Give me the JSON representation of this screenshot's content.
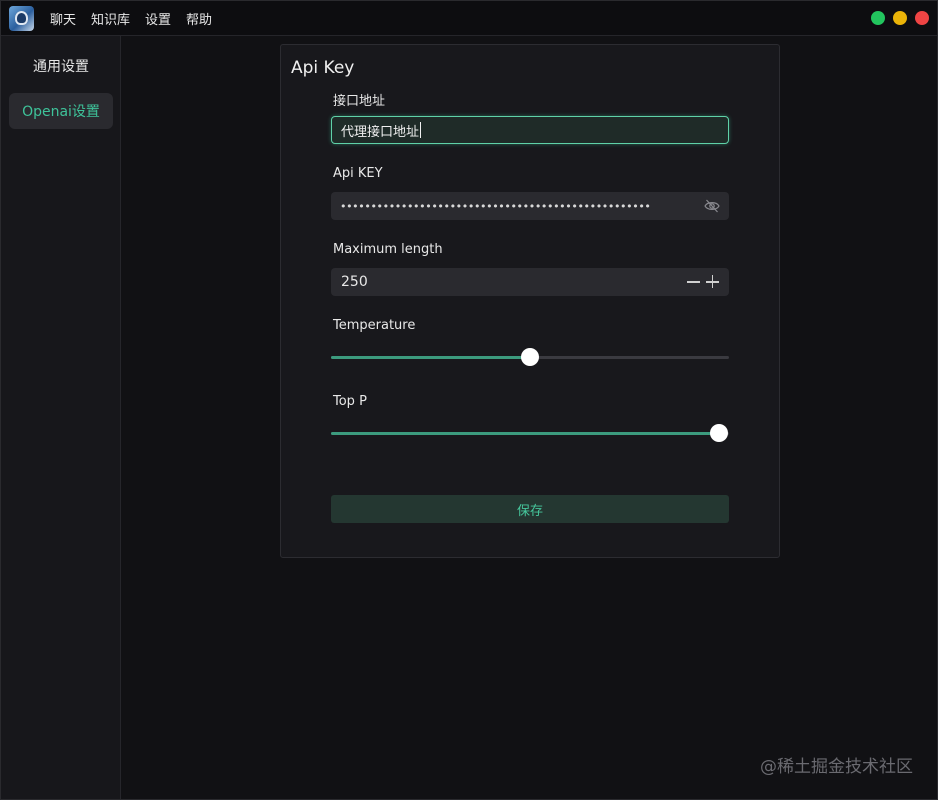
{
  "menu": [
    "聊天",
    "知识库",
    "设置",
    "帮助"
  ],
  "window_controls": {
    "colors": [
      "#22c55e",
      "#eab308",
      "#ef4444"
    ]
  },
  "sidebar": {
    "items": [
      {
        "label": "通用设置",
        "active": false
      },
      {
        "label": "Openai设置",
        "active": true
      }
    ]
  },
  "card": {
    "title": "Api Key",
    "endpoint": {
      "label": "接口地址",
      "value": "代理接口地址"
    },
    "api_key": {
      "label": "Api KEY",
      "masked_value": "•••••••••••••••••••••••••••••••••••••••••••••••••••",
      "toggle_icon": "eye-off-icon"
    },
    "max_length": {
      "label": "Maximum length",
      "value": "250"
    },
    "temperature": {
      "label": "Temperature",
      "value_fraction": 0.5
    },
    "top_p": {
      "label": "Top P",
      "value_fraction": 0.975
    },
    "save_label": "保存"
  },
  "accent_color": "#3ec39a",
  "watermark": "@稀土掘金技术社区"
}
